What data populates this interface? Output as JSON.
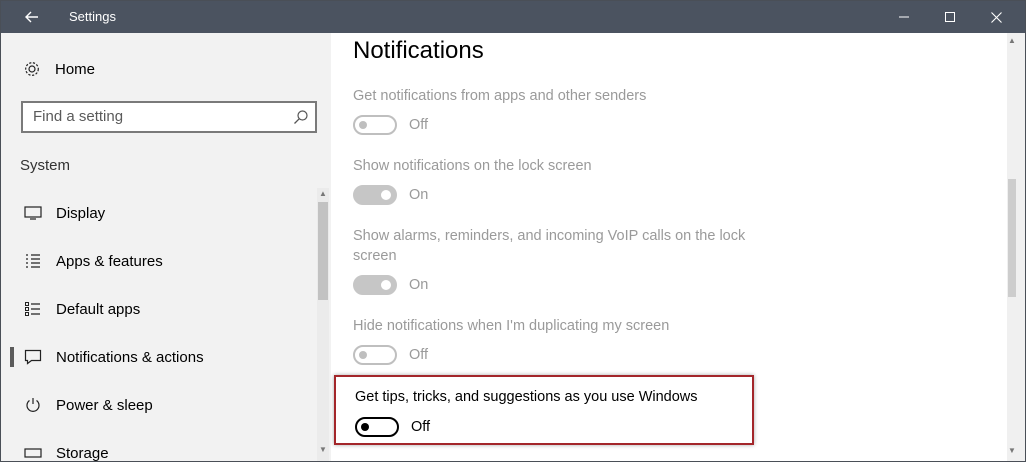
{
  "window": {
    "title": "Settings"
  },
  "sidebar": {
    "home_label": "Home",
    "search_placeholder": "Find a setting",
    "section_label": "System",
    "items": [
      {
        "label": "Display",
        "icon": "display-icon"
      },
      {
        "label": "Apps & features",
        "icon": "apps-list-icon"
      },
      {
        "label": "Default apps",
        "icon": "default-apps-icon"
      },
      {
        "label": "Notifications & actions",
        "icon": "notification-icon",
        "active": true
      },
      {
        "label": "Power & sleep",
        "icon": "power-icon"
      },
      {
        "label": "Storage",
        "icon": "storage-icon"
      }
    ]
  },
  "content": {
    "title": "Notifications",
    "settings": [
      {
        "label": "Get notifications from apps and other senders",
        "state": "Off"
      },
      {
        "label": "Show notifications on the lock screen",
        "state": "On"
      },
      {
        "label": "Show alarms, reminders, and incoming VoIP calls on the lock screen",
        "state": "On"
      },
      {
        "label": "Hide notifications when I'm duplicating my screen",
        "state": "Off"
      },
      {
        "label": "Get tips, tricks, and suggestions as you use Windows",
        "state": "Off"
      }
    ]
  }
}
